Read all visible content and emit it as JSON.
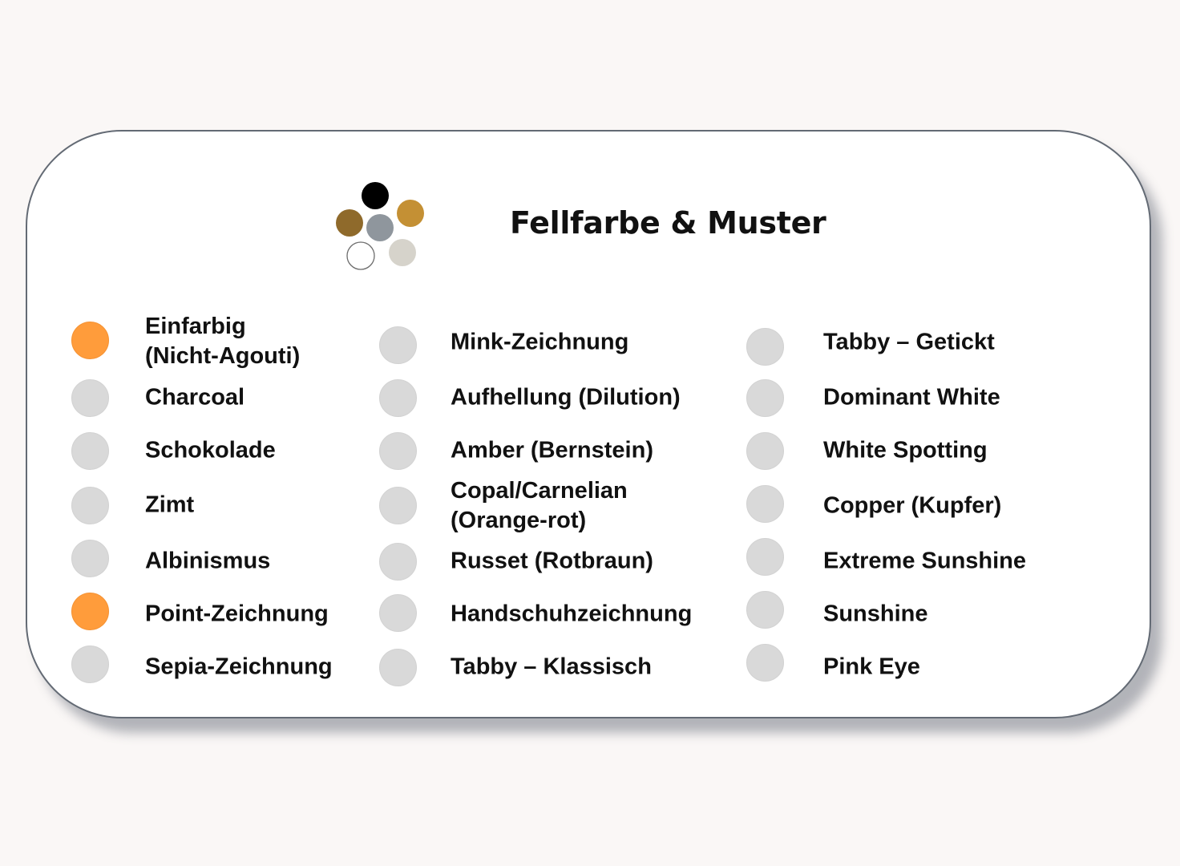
{
  "header": {
    "title": "Fellfarbe & Muster",
    "logo_icon": "paint-palette-dots-icon",
    "logo_colors": [
      "#000000",
      "#c49034",
      "#8f6a2b",
      "#8f969d",
      "#ffffff",
      "#d6d3cb"
    ]
  },
  "colors": {
    "active": "#ff9c3b",
    "inactive": "#d9d9d9"
  },
  "columns": [
    [
      {
        "label": "Einfarbig\n(Nicht-Agouti)",
        "selected": true
      },
      {
        "label": "Charcoal",
        "selected": false
      },
      {
        "label": "Schokolade",
        "selected": false
      },
      {
        "label": "Zimt",
        "selected": false
      },
      {
        "label": "Albinismus",
        "selected": false
      },
      {
        "label": "Point-Zeichnung",
        "selected": true
      },
      {
        "label": "Sepia-Zeichnung",
        "selected": false
      }
    ],
    [
      {
        "label": "Mink-Zeichnung",
        "selected": false
      },
      {
        "label": "Aufhellung (Dilution)",
        "selected": false
      },
      {
        "label": "Amber (Bernstein)",
        "selected": false
      },
      {
        "label": "Copal/Carnelian\n(Orange-rot)",
        "selected": false
      },
      {
        "label": "Russet (Rotbraun)",
        "selected": false
      },
      {
        "label": "Handschuhzeichnung",
        "selected": false
      },
      {
        "label": "Tabby – Klassisch",
        "selected": false
      }
    ],
    [
      {
        "label": "Tabby – Getickt",
        "selected": false
      },
      {
        "label": "Dominant White",
        "selected": false
      },
      {
        "label": "White Spotting",
        "selected": false
      },
      {
        "label": "Copper (Kupfer)",
        "selected": false
      },
      {
        "label": "Extreme Sunshine",
        "selected": false
      },
      {
        "label": "Sunshine",
        "selected": false
      },
      {
        "label": "Pink Eye",
        "selected": false
      }
    ]
  ]
}
